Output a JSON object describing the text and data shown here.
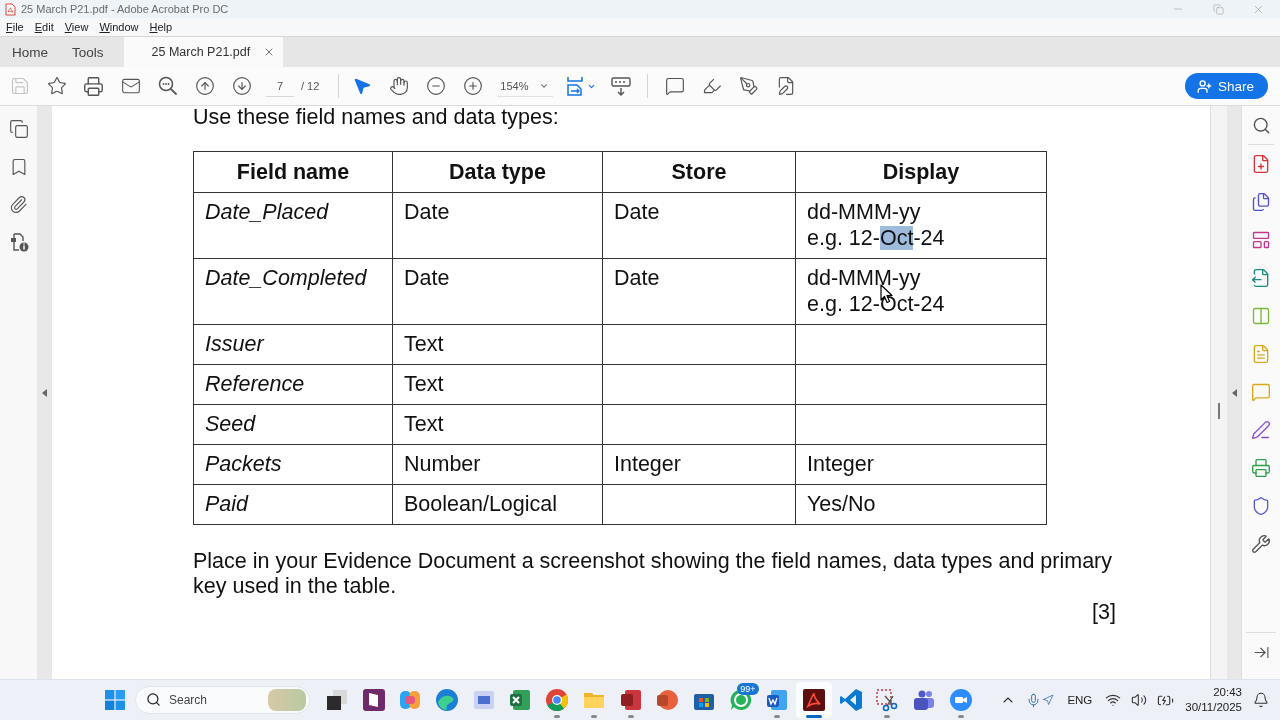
{
  "window": {
    "title": "25 March P21.pdf - Adobe Acrobat Pro DC"
  },
  "menu": [
    "File",
    "Edit",
    "View",
    "Window",
    "Help"
  ],
  "tabs": [
    {
      "label": "Home",
      "selected": false,
      "kind": "nav"
    },
    {
      "label": "Tools",
      "selected": false,
      "kind": "nav"
    },
    {
      "label": "25 March P21.pdf",
      "selected": true,
      "kind": "document"
    }
  ],
  "toolbar": {
    "save": {
      "disabled": true
    },
    "page": {
      "value": "7",
      "total": "/ 12"
    },
    "tools": [
      {
        "kind": "pointer",
        "selected": true
      },
      {
        "kind": "hand",
        "selected": false
      }
    ],
    "zoom": {
      "value": "154%"
    },
    "share": "Share"
  },
  "document": {
    "intro": "Use these field names and data types:",
    "table": {
      "columns": [
        "Field name",
        "Data type",
        "Store",
        "Display"
      ],
      "rows": [
        {
          "field": "Date_Placed",
          "data_type": "Date",
          "store": "Date",
          "display": [
            [
              {
                "text": "dd-MMM-yy",
                "selected": false
              }
            ],
            [
              {
                "text": "e.g. 12-",
                "selected": false
              },
              {
                "text": "Oct",
                "selected": true
              },
              {
                "text": "-24",
                "selected": false
              }
            ]
          ]
        },
        {
          "field": "Date_Completed",
          "data_type": "Date",
          "store": "Date",
          "display": [
            [
              {
                "text": "dd-MMM-yy",
                "selected": false
              }
            ],
            [
              {
                "text": "e.g. 12-Oct-24",
                "selected": false
              }
            ]
          ]
        },
        {
          "field": "Issuer",
          "data_type": "Text"
        },
        {
          "field": "Reference",
          "data_type": "Text"
        },
        {
          "field": "Seed",
          "data_type": "Text"
        },
        {
          "field": "Packets",
          "data_type": "Number",
          "store": "Integer",
          "display": [
            [
              {
                "text": "Integer",
                "selected": false
              }
            ]
          ]
        },
        {
          "field": "Paid",
          "data_type": "Boolean/Logical",
          "display": [
            [
              {
                "text": "Yes/No",
                "selected": false
              }
            ]
          ]
        }
      ]
    },
    "instruction": "Place in your Evidence Document a screenshot showing the field names, data types and primary key used in the table.",
    "marks": "[3]"
  },
  "taskbar": {
    "search": {
      "placeholder": "Search"
    },
    "apps": [
      {
        "kind": "taskview",
        "running": false,
        "active": false
      },
      {
        "kind": "notes",
        "running": false,
        "active": false
      },
      {
        "kind": "assistant",
        "running": false,
        "active": false
      },
      {
        "kind": "wave",
        "running": false,
        "active": false
      },
      {
        "kind": "gallery",
        "running": false,
        "active": false
      },
      {
        "kind": "sheet",
        "running": false,
        "active": false
      },
      {
        "kind": "ring",
        "running": true,
        "active": false
      },
      {
        "kind": "folder",
        "running": true,
        "active": false
      },
      {
        "kind": "database",
        "running": true,
        "active": false
      },
      {
        "kind": "slides",
        "running": false,
        "active": false
      },
      {
        "kind": "store",
        "running": false,
        "active": false
      },
      {
        "kind": "chat",
        "running": false,
        "active": false,
        "badge": "99+"
      },
      {
        "kind": "document",
        "running": true,
        "active": false
      },
      {
        "kind": "pdf",
        "running": true,
        "active": true
      },
      {
        "kind": "editor",
        "running": false,
        "active": false
      },
      {
        "kind": "snip",
        "running": true,
        "active": false
      },
      {
        "kind": "people",
        "running": false,
        "active": false
      },
      {
        "kind": "video",
        "running": true,
        "active": false
      }
    ],
    "tray": {
      "language": "ENG",
      "time": "20:43",
      "date": "30/11/2025"
    }
  }
}
